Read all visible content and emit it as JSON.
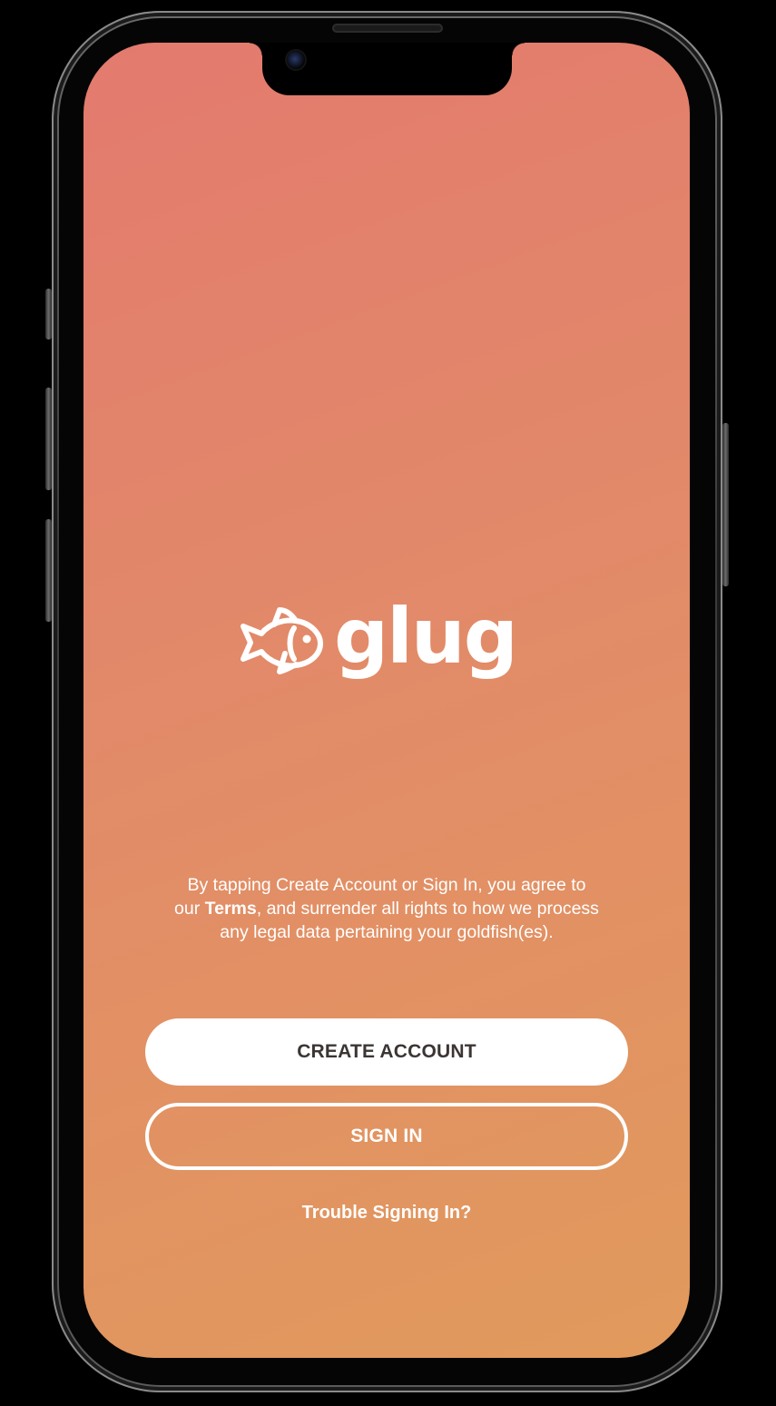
{
  "app": {
    "name": "glug",
    "logo_icon": "goldfish-icon"
  },
  "legal": {
    "prefix": "By tapping Create Account or Sign In, you agree to our ",
    "terms_link": "Terms",
    "suffix": ", and surrender all rights to how we process any legal data pertaining your goldfish(es)."
  },
  "buttons": {
    "create_account": "CREATE ACCOUNT",
    "sign_in": "SIGN IN",
    "trouble": "Trouble Signing In?"
  },
  "colors": {
    "gradient_start": "#e37a6e",
    "gradient_end": "#e19a5c",
    "button_text_dark": "#3b3533",
    "white": "#ffffff"
  }
}
